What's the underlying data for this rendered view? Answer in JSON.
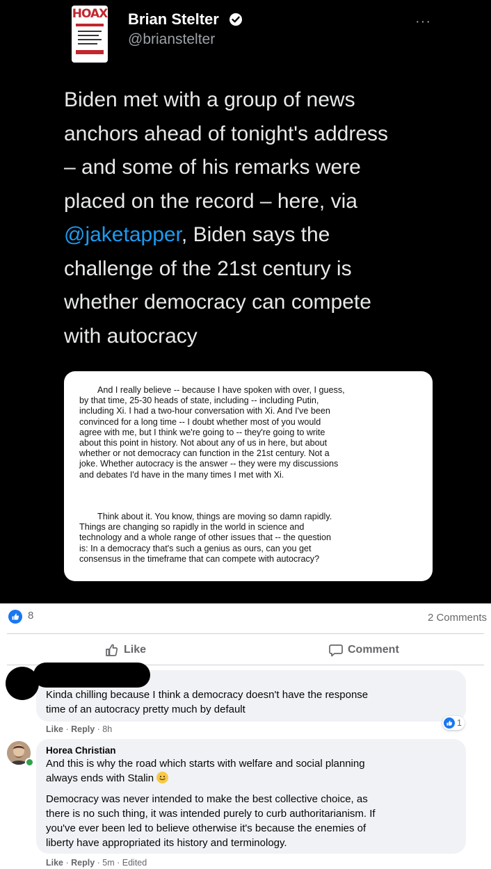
{
  "tweet": {
    "avatar_label": "HOAX",
    "author_name": "Brian Stelter",
    "handle": "@brianstelter",
    "more_label": "···",
    "text_lines": [
      "Biden met with a group of news",
      "anchors ahead of tonight's address",
      "– and some of his remarks were",
      "placed on the record – here, via"
    ],
    "mention": "@jaketapper",
    "mention_rest": ", Biden says the",
    "text_lines_after": [
      "challenge of the 21st century is",
      "whether democracy can compete",
      "with autocracy"
    ],
    "quote_para1": [
      "And I really believe -- because I have spoken with over, I guess,",
      "by that time, 25-30 heads of state, including -- including Putin,",
      "including Xi.  I had a two-hour conversation with Xi.  And I've been",
      "convinced for a long time -- I doubt whether most of you would",
      "agree with me, but I think we're going to -- they're going to write",
      "about this point in history.  Not about any of us in here, but about",
      "whether or not democracy can function in the 21st century.  Not a",
      "joke.  Whether autocracy is the answer -- they were my discussions",
      "and debates I'd have in the many times I met with Xi."
    ],
    "quote_para2": [
      "Think about it.  You know, things are moving so damn rapidly.",
      "Things are changing so rapidly in the world in science and",
      "technology and a whole range of other issues that -- the question",
      "is:  In a democracy that's such a genius as ours, can you get",
      "consensus in the timeframe that can compete with autocracy?"
    ]
  },
  "post": {
    "reaction_count": "8",
    "comments_count": "2 Comments",
    "like_label": "Like",
    "comment_label": "Comment"
  },
  "comments": [
    {
      "lines": [
        "Kinda chilling because I think a democracy doesn't have the response",
        "time of an autocracy pretty much by default"
      ],
      "like": "Like",
      "reply": "Reply",
      "time": "8h",
      "reactions": "1"
    },
    {
      "author": "Horea Christian",
      "lines1": [
        "And this is why the road which starts with welfare and social planning",
        "always ends with Stalin"
      ],
      "lines2": [
        "Democracy was never intended to make the best collective choice, as",
        "there is no such thing, it was intended purely to curb authoritarianism. If",
        "you've ever been led to believe otherwise it's because the enemies of",
        "liberty have appropriated its history and terminology."
      ],
      "like": "Like",
      "reply": "Reply",
      "time": "5m",
      "edited": "Edited"
    }
  ],
  "colors": {
    "tweet_bg": "#000000",
    "mention": "#1d9bf0",
    "fb_blue": "#1877f2",
    "bubble": "#f0f2f5"
  }
}
